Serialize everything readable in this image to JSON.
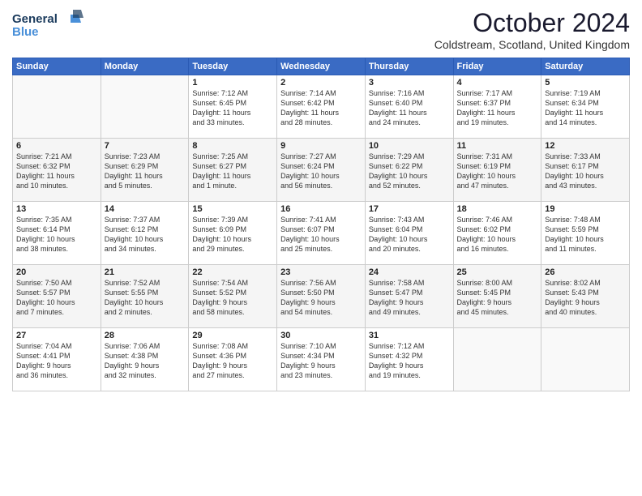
{
  "logo": {
    "line1": "General",
    "line2": "Blue"
  },
  "title": "October 2024",
  "location": "Coldstream, Scotland, United Kingdom",
  "days_of_week": [
    "Sunday",
    "Monday",
    "Tuesday",
    "Wednesday",
    "Thursday",
    "Friday",
    "Saturday"
  ],
  "weeks": [
    [
      {
        "day": "",
        "info": ""
      },
      {
        "day": "",
        "info": ""
      },
      {
        "day": "1",
        "info": "Sunrise: 7:12 AM\nSunset: 6:45 PM\nDaylight: 11 hours\nand 33 minutes."
      },
      {
        "day": "2",
        "info": "Sunrise: 7:14 AM\nSunset: 6:42 PM\nDaylight: 11 hours\nand 28 minutes."
      },
      {
        "day": "3",
        "info": "Sunrise: 7:16 AM\nSunset: 6:40 PM\nDaylight: 11 hours\nand 24 minutes."
      },
      {
        "day": "4",
        "info": "Sunrise: 7:17 AM\nSunset: 6:37 PM\nDaylight: 11 hours\nand 19 minutes."
      },
      {
        "day": "5",
        "info": "Sunrise: 7:19 AM\nSunset: 6:34 PM\nDaylight: 11 hours\nand 14 minutes."
      }
    ],
    [
      {
        "day": "6",
        "info": "Sunrise: 7:21 AM\nSunset: 6:32 PM\nDaylight: 11 hours\nand 10 minutes."
      },
      {
        "day": "7",
        "info": "Sunrise: 7:23 AM\nSunset: 6:29 PM\nDaylight: 11 hours\nand 5 minutes."
      },
      {
        "day": "8",
        "info": "Sunrise: 7:25 AM\nSunset: 6:27 PM\nDaylight: 11 hours\nand 1 minute."
      },
      {
        "day": "9",
        "info": "Sunrise: 7:27 AM\nSunset: 6:24 PM\nDaylight: 10 hours\nand 56 minutes."
      },
      {
        "day": "10",
        "info": "Sunrise: 7:29 AM\nSunset: 6:22 PM\nDaylight: 10 hours\nand 52 minutes."
      },
      {
        "day": "11",
        "info": "Sunrise: 7:31 AM\nSunset: 6:19 PM\nDaylight: 10 hours\nand 47 minutes."
      },
      {
        "day": "12",
        "info": "Sunrise: 7:33 AM\nSunset: 6:17 PM\nDaylight: 10 hours\nand 43 minutes."
      }
    ],
    [
      {
        "day": "13",
        "info": "Sunrise: 7:35 AM\nSunset: 6:14 PM\nDaylight: 10 hours\nand 38 minutes."
      },
      {
        "day": "14",
        "info": "Sunrise: 7:37 AM\nSunset: 6:12 PM\nDaylight: 10 hours\nand 34 minutes."
      },
      {
        "day": "15",
        "info": "Sunrise: 7:39 AM\nSunset: 6:09 PM\nDaylight: 10 hours\nand 29 minutes."
      },
      {
        "day": "16",
        "info": "Sunrise: 7:41 AM\nSunset: 6:07 PM\nDaylight: 10 hours\nand 25 minutes."
      },
      {
        "day": "17",
        "info": "Sunrise: 7:43 AM\nSunset: 6:04 PM\nDaylight: 10 hours\nand 20 minutes."
      },
      {
        "day": "18",
        "info": "Sunrise: 7:46 AM\nSunset: 6:02 PM\nDaylight: 10 hours\nand 16 minutes."
      },
      {
        "day": "19",
        "info": "Sunrise: 7:48 AM\nSunset: 5:59 PM\nDaylight: 10 hours\nand 11 minutes."
      }
    ],
    [
      {
        "day": "20",
        "info": "Sunrise: 7:50 AM\nSunset: 5:57 PM\nDaylight: 10 hours\nand 7 minutes."
      },
      {
        "day": "21",
        "info": "Sunrise: 7:52 AM\nSunset: 5:55 PM\nDaylight: 10 hours\nand 2 minutes."
      },
      {
        "day": "22",
        "info": "Sunrise: 7:54 AM\nSunset: 5:52 PM\nDaylight: 9 hours\nand 58 minutes."
      },
      {
        "day": "23",
        "info": "Sunrise: 7:56 AM\nSunset: 5:50 PM\nDaylight: 9 hours\nand 54 minutes."
      },
      {
        "day": "24",
        "info": "Sunrise: 7:58 AM\nSunset: 5:47 PM\nDaylight: 9 hours\nand 49 minutes."
      },
      {
        "day": "25",
        "info": "Sunrise: 8:00 AM\nSunset: 5:45 PM\nDaylight: 9 hours\nand 45 minutes."
      },
      {
        "day": "26",
        "info": "Sunrise: 8:02 AM\nSunset: 5:43 PM\nDaylight: 9 hours\nand 40 minutes."
      }
    ],
    [
      {
        "day": "27",
        "info": "Sunrise: 7:04 AM\nSunset: 4:41 PM\nDaylight: 9 hours\nand 36 minutes."
      },
      {
        "day": "28",
        "info": "Sunrise: 7:06 AM\nSunset: 4:38 PM\nDaylight: 9 hours\nand 32 minutes."
      },
      {
        "day": "29",
        "info": "Sunrise: 7:08 AM\nSunset: 4:36 PM\nDaylight: 9 hours\nand 27 minutes."
      },
      {
        "day": "30",
        "info": "Sunrise: 7:10 AM\nSunset: 4:34 PM\nDaylight: 9 hours\nand 23 minutes."
      },
      {
        "day": "31",
        "info": "Sunrise: 7:12 AM\nSunset: 4:32 PM\nDaylight: 9 hours\nand 19 minutes."
      },
      {
        "day": "",
        "info": ""
      },
      {
        "day": "",
        "info": ""
      }
    ]
  ]
}
